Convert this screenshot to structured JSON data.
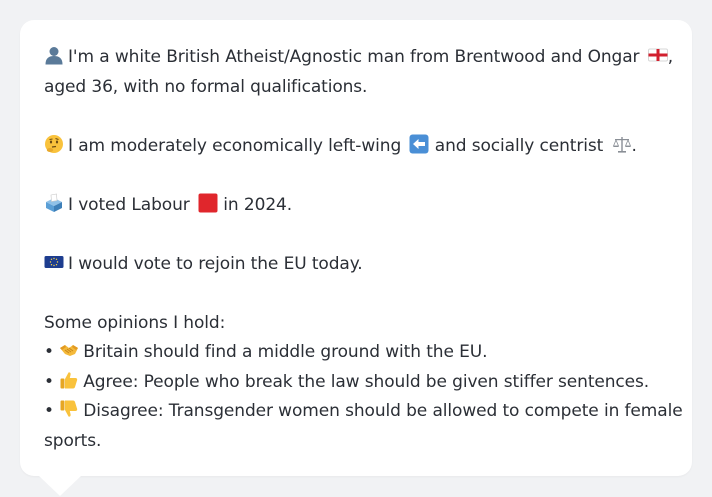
{
  "profile": {
    "intro_line1": "I'm a white British Atheist/Agnostic man from Brentwood and Ongar",
    "intro_line1_end": ",",
    "intro_line2": "aged 36, with no formal qualifications.",
    "economics_text": "I am moderately economically left-wing",
    "social_text": "and socially centrist",
    "social_end": ".",
    "vote_pre": "I voted Labour",
    "vote_post": "in 2024.",
    "eu_text": "I would vote to rejoin the EU today."
  },
  "opinions": {
    "heading": "Some opinions I hold:",
    "bullet": "•",
    "items": [
      {
        "icon": "handshake-icon",
        "text": "Britain should find a middle ground with the EU."
      },
      {
        "icon": "thumbs-up-icon",
        "text": "Agree: People who break the law should be given stiffer sentences."
      },
      {
        "icon": "thumbs-down-icon",
        "text": "Disagree: Transgender women should be allowed to compete in female",
        "text_cont": "sports."
      }
    ]
  },
  "icons": [
    "person-icon",
    "england-flag-icon",
    "thinking-face-icon",
    "left-arrow-icon",
    "balance-scale-icon",
    "ballot-box-icon",
    "red-square-icon",
    "eu-flag-icon",
    "handshake-icon",
    "thumbs-up-icon",
    "thumbs-down-icon"
  ],
  "colors": {
    "background": "#f1f2f4",
    "bubble": "#ffffff",
    "text": "#2b2f36",
    "labour_red": "#e0262c",
    "eu_blue": "#1d3d8f"
  }
}
